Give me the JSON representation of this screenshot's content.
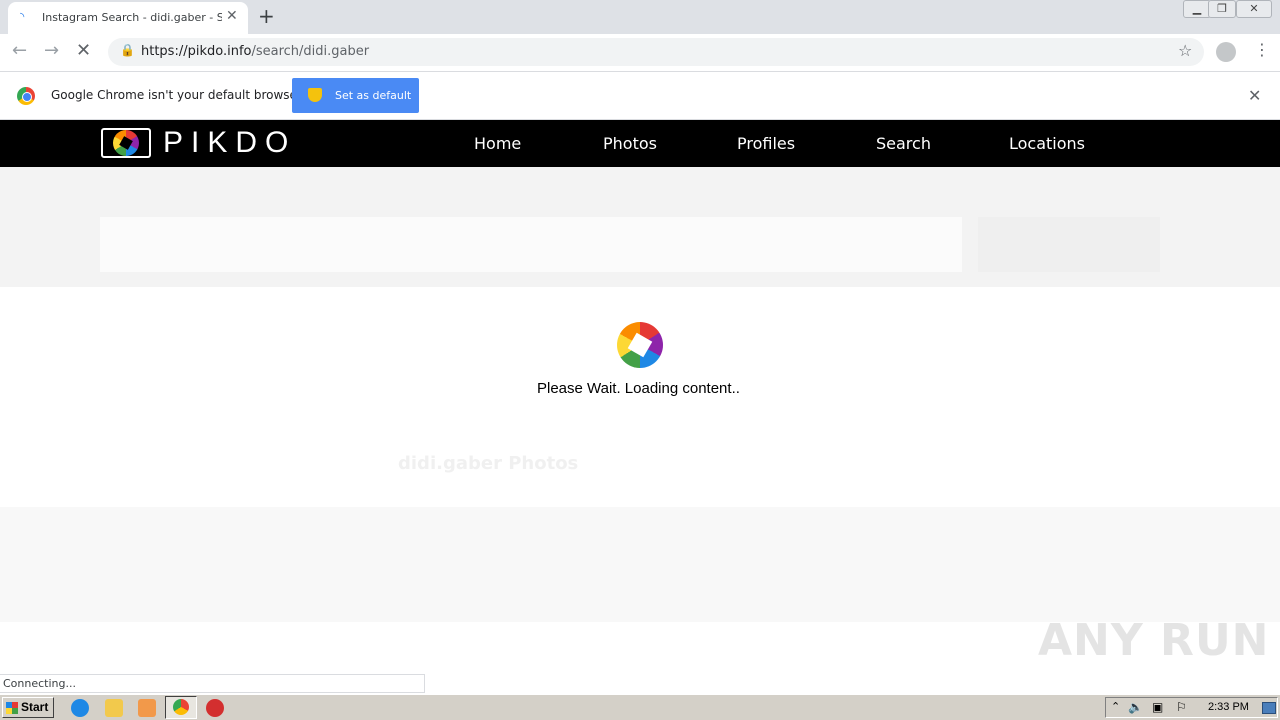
{
  "browser": {
    "tab_title": "Instagram Search - didi.gaber - Se",
    "url_host": "https://pikdo.info",
    "url_path": "/search/didi.gaber",
    "infobar_text": "Google Chrome isn't your default browser",
    "set_default_label": "Set as default",
    "status_text": "Connecting..."
  },
  "site": {
    "logo_text": "PIKDO",
    "nav": [
      {
        "label": "Home"
      },
      {
        "label": "Photos"
      },
      {
        "label": "Profiles"
      },
      {
        "label": "Search"
      },
      {
        "label": "Locations"
      }
    ],
    "faded_title": "didi.gaber Photos",
    "loading_text": "Please Wait. Loading content.."
  },
  "watermark": "ANY RUN",
  "taskbar": {
    "start_label": "Start",
    "clock": "2:33 PM"
  }
}
